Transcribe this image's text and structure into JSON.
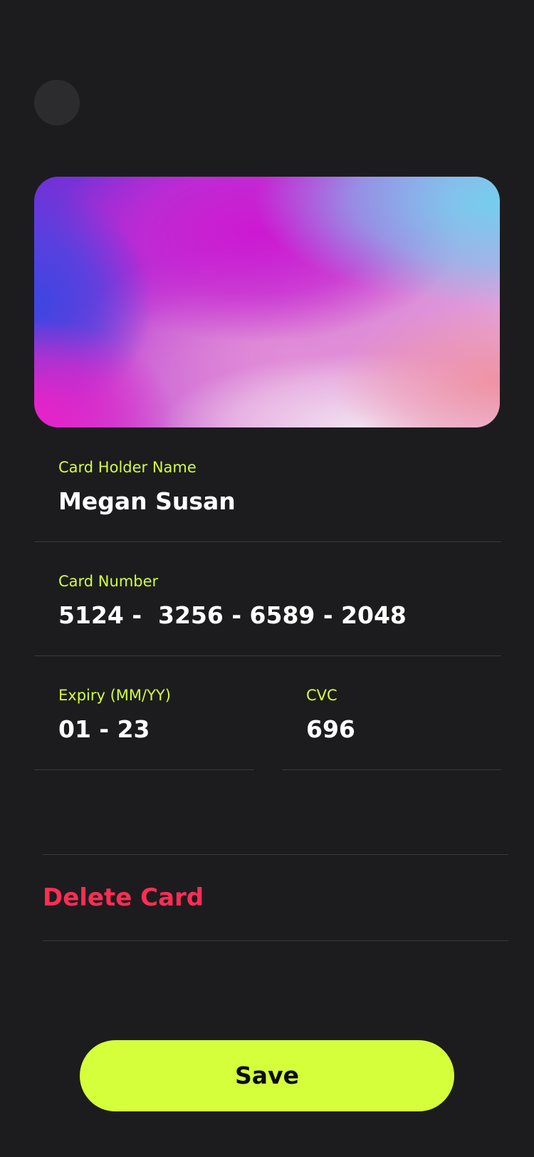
{
  "header": {
    "back_icon": "back-icon"
  },
  "card": {
    "style": "gradient"
  },
  "form": {
    "holder_label": "Card Holder Name",
    "holder_value": "Megan Susan",
    "number_label": "Card Number",
    "number_value": "5124 -  3256 - 6589 - 2048",
    "expiry_label": "Expiry (MM/YY)",
    "expiry_value": "01 - 23",
    "cvc_label": "CVC",
    "cvc_value": "696"
  },
  "actions": {
    "delete_label": "Delete Card",
    "save_label": "Save"
  },
  "colors": {
    "background": "#1c1c1e",
    "accent": "#d4ff3a",
    "danger": "#ff2d55",
    "divider": "#3a3a3d"
  }
}
